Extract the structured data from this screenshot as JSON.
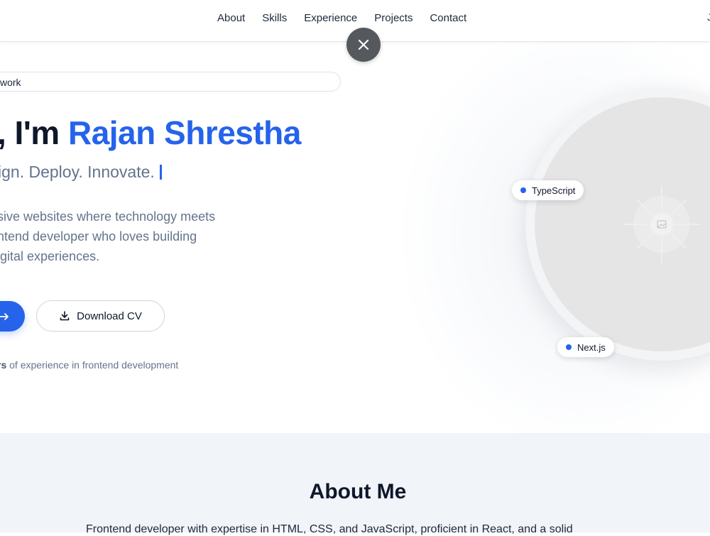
{
  "nav": {
    "items": [
      {
        "label": "About"
      },
      {
        "label": "Skills"
      },
      {
        "label": "Experience"
      },
      {
        "label": "Projects"
      },
      {
        "label": "Contact"
      }
    ],
    "edge_text": "J"
  },
  "overlay": {
    "close_icon": "close-icon"
  },
  "hero": {
    "badge": "work",
    "headline_prefix": ", I'm ",
    "headline_name": "Rajan Shrestha",
    "tagline": "ign. Deploy. Innovate.",
    "description": [
      "sive websites where technology meets",
      "ntend developer who loves building",
      "igital experiences."
    ],
    "primary_icon": "arrow-right-icon",
    "download_label": "Download CV",
    "download_icon": "download-icon",
    "experience_bold": "rs",
    "experience_rest": " of experience in frontend development",
    "tech_pills": [
      {
        "label": "TypeScript"
      },
      {
        "label": "Next.js"
      }
    ],
    "image_icon": "image-placeholder-icon"
  },
  "about": {
    "title": "About Me",
    "text": "Frontend developer with expertise in HTML, CSS, and JavaScript, proficient in React, and a solid"
  },
  "colors": {
    "accent": "#2563eb",
    "muted": "#64748b",
    "section_bg": "#f1f4f8"
  }
}
